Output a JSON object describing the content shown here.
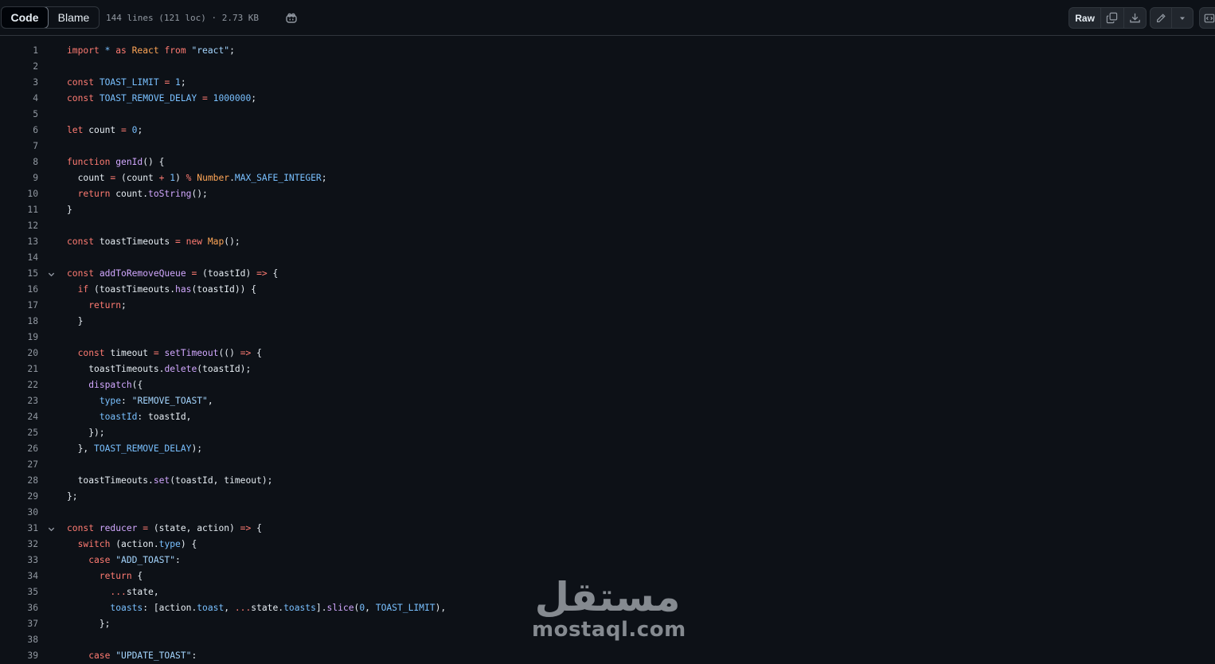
{
  "toolbar": {
    "code_label": "Code",
    "blame_label": "Blame",
    "file_info": "144 lines (121 loc) · 2.73 KB",
    "raw_label": "Raw",
    "icons": [
      "copilot-icon",
      "copy-icon",
      "download-icon",
      "pencil-icon",
      "chevron-down-icon",
      "symbols-icon"
    ]
  },
  "colors": {
    "background": "#0d1117",
    "keyword": "#ff7b72",
    "constant": "#79c0ff",
    "string": "#a5d6ff",
    "function": "#d2a8ff",
    "entity": "#ffa657",
    "line_number": "#9198a1"
  },
  "code": {
    "folded_lines": [
      15,
      31
    ],
    "lines": [
      [
        {
          "t": "import ",
          "c": "kw"
        },
        {
          "t": "* ",
          "c": "cst"
        },
        {
          "t": "as ",
          "c": "kw"
        },
        {
          "t": "React ",
          "c": "ent"
        },
        {
          "t": "from ",
          "c": "kw"
        },
        {
          "t": "\"react\"",
          "c": "str"
        },
        {
          "t": ";"
        }
      ],
      [],
      [
        {
          "t": "const ",
          "c": "kw"
        },
        {
          "t": "TOAST_LIMIT",
          "c": "cst"
        },
        {
          "t": " = ",
          "c": "kw"
        },
        {
          "t": "1",
          "c": "cst"
        },
        {
          "t": ";"
        }
      ],
      [
        {
          "t": "const ",
          "c": "kw"
        },
        {
          "t": "TOAST_REMOVE_DELAY",
          "c": "cst"
        },
        {
          "t": " = ",
          "c": "kw"
        },
        {
          "t": "1000000",
          "c": "cst"
        },
        {
          "t": ";"
        }
      ],
      [],
      [
        {
          "t": "let ",
          "c": "kw"
        },
        {
          "t": "count "
        },
        {
          "t": "= ",
          "c": "kw"
        },
        {
          "t": "0",
          "c": "cst"
        },
        {
          "t": ";"
        }
      ],
      [],
      [
        {
          "t": "function ",
          "c": "kw"
        },
        {
          "t": "genId",
          "c": "fn"
        },
        {
          "t": "() {"
        }
      ],
      [
        {
          "t": "  count "
        },
        {
          "t": "= ",
          "c": "kw"
        },
        {
          "t": "(count "
        },
        {
          "t": "+ ",
          "c": "kw"
        },
        {
          "t": "1",
          "c": "cst"
        },
        {
          "t": ") "
        },
        {
          "t": "% ",
          "c": "kw"
        },
        {
          "t": "Number",
          "c": "ent"
        },
        {
          "t": "."
        },
        {
          "t": "MAX_SAFE_INTEGER",
          "c": "cst"
        },
        {
          "t": ";"
        }
      ],
      [
        {
          "t": "  return ",
          "c": "kw"
        },
        {
          "t": "count."
        },
        {
          "t": "toString",
          "c": "fn"
        },
        {
          "t": "();"
        }
      ],
      [
        {
          "t": "}"
        }
      ],
      [],
      [
        {
          "t": "const ",
          "c": "kw"
        },
        {
          "t": "toastTimeouts "
        },
        {
          "t": "= ",
          "c": "kw"
        },
        {
          "t": "new ",
          "c": "kw"
        },
        {
          "t": "Map",
          "c": "ent"
        },
        {
          "t": "();"
        }
      ],
      [],
      [
        {
          "t": "const ",
          "c": "kw"
        },
        {
          "t": "addToRemoveQueue",
          "c": "fn"
        },
        {
          "t": " = ",
          "c": "kw"
        },
        {
          "t": "(toastId) "
        },
        {
          "t": "=> ",
          "c": "kw"
        },
        {
          "t": "{"
        }
      ],
      [
        {
          "t": "  if ",
          "c": "kw"
        },
        {
          "t": "(toastTimeouts."
        },
        {
          "t": "has",
          "c": "fn"
        },
        {
          "t": "(toastId)) {"
        }
      ],
      [
        {
          "t": "    return",
          "c": "kw"
        },
        {
          "t": ";"
        }
      ],
      [
        {
          "t": "  }"
        }
      ],
      [],
      [
        {
          "t": "  const ",
          "c": "kw"
        },
        {
          "t": "timeout "
        },
        {
          "t": "= ",
          "c": "kw"
        },
        {
          "t": "setTimeout",
          "c": "fn"
        },
        {
          "t": "(() "
        },
        {
          "t": "=> ",
          "c": "kw"
        },
        {
          "t": "{"
        }
      ],
      [
        {
          "t": "    toastTimeouts."
        },
        {
          "t": "delete",
          "c": "fn"
        },
        {
          "t": "(toastId);"
        }
      ],
      [
        {
          "t": "    "
        },
        {
          "t": "dispatch",
          "c": "fn"
        },
        {
          "t": "({"
        }
      ],
      [
        {
          "t": "      "
        },
        {
          "t": "type",
          "c": "cst"
        },
        {
          "t": ": "
        },
        {
          "t": "\"REMOVE_TOAST\"",
          "c": "str"
        },
        {
          "t": ","
        }
      ],
      [
        {
          "t": "      "
        },
        {
          "t": "toastId",
          "c": "cst"
        },
        {
          "t": ": toastId,"
        }
      ],
      [
        {
          "t": "    });"
        }
      ],
      [
        {
          "t": "  }, "
        },
        {
          "t": "TOAST_REMOVE_DELAY",
          "c": "cst"
        },
        {
          "t": ");"
        }
      ],
      [],
      [
        {
          "t": "  toastTimeouts."
        },
        {
          "t": "set",
          "c": "fn"
        },
        {
          "t": "(toastId, timeout);"
        }
      ],
      [
        {
          "t": "};"
        }
      ],
      [],
      [
        {
          "t": "const ",
          "c": "kw"
        },
        {
          "t": "reducer",
          "c": "fn"
        },
        {
          "t": " = ",
          "c": "kw"
        },
        {
          "t": "(state, action) "
        },
        {
          "t": "=> ",
          "c": "kw"
        },
        {
          "t": "{"
        }
      ],
      [
        {
          "t": "  switch ",
          "c": "kw"
        },
        {
          "t": "(action."
        },
        {
          "t": "type",
          "c": "cst"
        },
        {
          "t": ") {"
        }
      ],
      [
        {
          "t": "    case ",
          "c": "kw"
        },
        {
          "t": "\"ADD_TOAST\"",
          "c": "str"
        },
        {
          "t": ":"
        }
      ],
      [
        {
          "t": "      return ",
          "c": "kw"
        },
        {
          "t": "{"
        }
      ],
      [
        {
          "t": "        ",
          "c": ""
        },
        {
          "t": "...",
          "c": "kw"
        },
        {
          "t": "state,"
        }
      ],
      [
        {
          "t": "        "
        },
        {
          "t": "toasts",
          "c": "cst"
        },
        {
          "t": ": [action."
        },
        {
          "t": "toast",
          "c": "cst"
        },
        {
          "t": ", "
        },
        {
          "t": "...",
          "c": "kw"
        },
        {
          "t": "state."
        },
        {
          "t": "toasts",
          "c": "cst"
        },
        {
          "t": "]."
        },
        {
          "t": "slice",
          "c": "fn"
        },
        {
          "t": "("
        },
        {
          "t": "0",
          "c": "cst"
        },
        {
          "t": ", "
        },
        {
          "t": "TOAST_LIMIT",
          "c": "cst"
        },
        {
          "t": "),"
        }
      ],
      [
        {
          "t": "      };"
        }
      ],
      [],
      [
        {
          "t": "    case ",
          "c": "kw"
        },
        {
          "t": "\"UPDATE_TOAST\"",
          "c": "str"
        },
        {
          "t": ":"
        }
      ]
    ]
  },
  "watermark": {
    "arabic": "مستقل",
    "latin": "mostaql.com"
  }
}
